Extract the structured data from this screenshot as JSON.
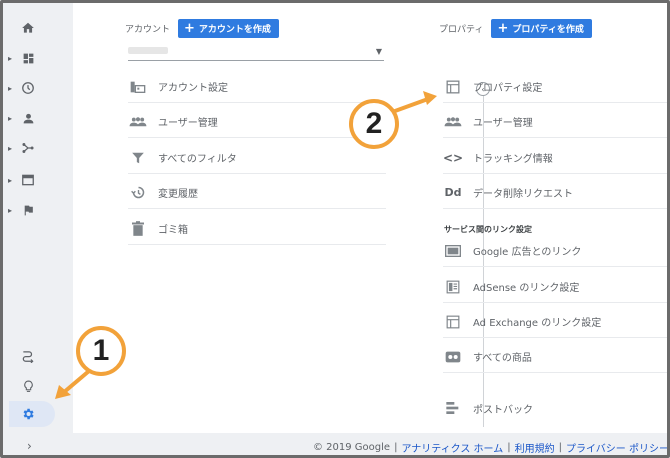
{
  "account": {
    "label": "アカウント",
    "create_button": "アカウントを作成",
    "items": [
      {
        "icon": "account-settings-icon",
        "label": "アカウント設定"
      },
      {
        "icon": "users-icon",
        "label": "ユーザー管理"
      },
      {
        "icon": "filter-icon",
        "label": "すべてのフィルタ"
      },
      {
        "icon": "history-icon",
        "label": "変更履歴"
      },
      {
        "icon": "trash-icon",
        "label": "ゴミ箱"
      }
    ]
  },
  "property": {
    "label": "プロパティ",
    "create_button": "プロパティを作成",
    "items": [
      {
        "icon": "property-settings-icon",
        "label": "プロパティ設定"
      },
      {
        "icon": "users-icon",
        "label": "ユーザー管理"
      },
      {
        "icon": "code-icon",
        "label": "トラッキング情報"
      },
      {
        "icon": "data-deletion-icon",
        "label": "データ削除リクエスト"
      }
    ],
    "section_label": "サービス間のリンク設定",
    "link_items": [
      {
        "icon": "google-ads-icon",
        "label": "Google 広告とのリンク"
      },
      {
        "icon": "adsense-icon",
        "label": "AdSense のリンク設定"
      },
      {
        "icon": "ad-exchange-icon",
        "label": "Ad Exchange のリンク設定"
      },
      {
        "icon": "all-products-icon",
        "label": "すべての商品"
      },
      {
        "icon": "postback-icon",
        "label": "ポストバック"
      }
    ]
  },
  "annotations": {
    "badge1": "1",
    "badge2": "2",
    "accent_color": "#f2a23a"
  },
  "footer": {
    "copyright": "© 2019 Google",
    "links": [
      "アナリティクス ホーム",
      "利用規約",
      "プライバシー ポリシー"
    ]
  },
  "colors": {
    "primary_button": "#2f7be0",
    "rail_bg": "#eef0f3"
  }
}
